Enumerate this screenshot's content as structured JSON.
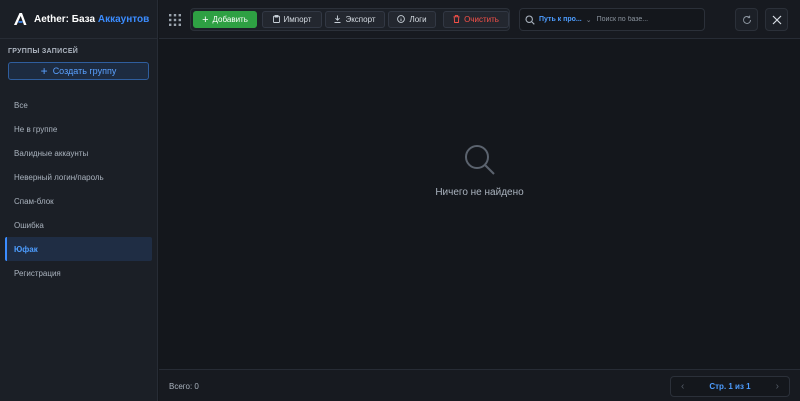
{
  "app": {
    "title_main": "Aether: База",
    "title_accent": "Аккаунтов",
    "accent_color": "#3b8cff",
    "success_color": "#2ea043",
    "danger_color": "#f85149"
  },
  "sidebar": {
    "heading": "ГРУППЫ ЗАПИСЕЙ",
    "create_button": "Создать группу",
    "groups": [
      {
        "label": "Все",
        "active": false
      },
      {
        "label": "Не в группе",
        "active": false
      },
      {
        "label": "Валидные аккаунты",
        "active": false
      },
      {
        "label": "Неверный логин/пароль",
        "active": false
      },
      {
        "label": "Спам-блок",
        "active": false
      },
      {
        "label": "Ошибка",
        "active": false
      },
      {
        "label": "Юфак",
        "active": true
      },
      {
        "label": "Регистрация",
        "active": false
      }
    ]
  },
  "toolbar": {
    "add": "Добавить",
    "import": "Импорт",
    "export": "Экспорт",
    "logs": "Логи",
    "clear": "Очистить"
  },
  "search": {
    "path_label": "Путь к про...",
    "placeholder": "Поиск по базе...",
    "value": ""
  },
  "icons": {
    "apps": "apps-grid-icon",
    "refresh": "refresh-icon",
    "close": "close-icon",
    "search": "search-icon"
  },
  "main": {
    "empty_text": "Ничего не найдено"
  },
  "footer": {
    "total": "Всего: 0",
    "page_label": "Стр. 1 из 1"
  }
}
